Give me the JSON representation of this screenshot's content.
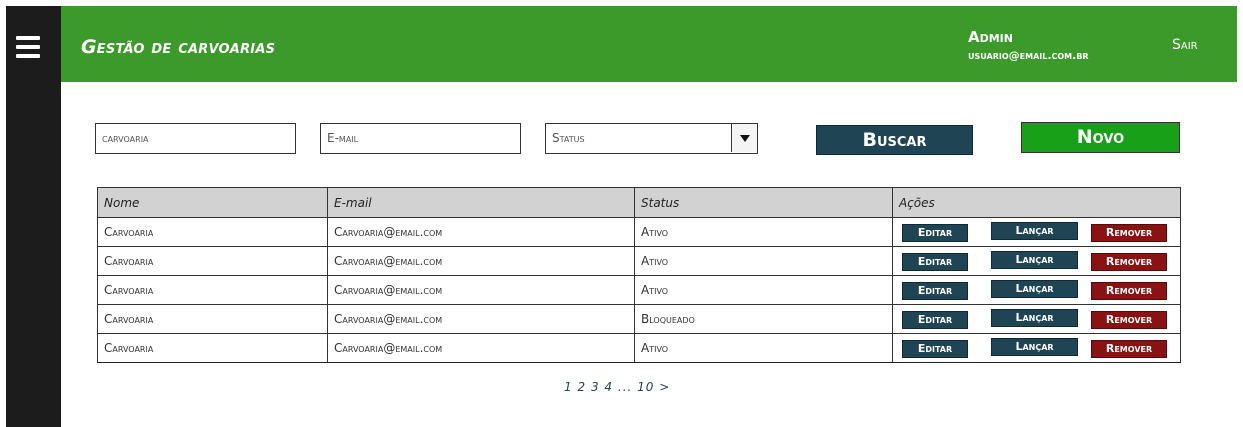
{
  "header": {
    "title": "Gestão de carvoarias",
    "user_name": "Admin",
    "user_email": "usuario@email.com.br",
    "logout_label": "Sair",
    "accent_color": "#3b9a2a"
  },
  "filters": {
    "carvoaria_placeholder": "carvoaria",
    "email_placeholder": "E-mail",
    "status_value": "Status",
    "search_label": "Buscar",
    "new_label": "Novo"
  },
  "table": {
    "headers": [
      "Nome",
      "E-mail",
      "Status",
      "Ações"
    ],
    "rows": [
      {
        "nome": "Carvoaria",
        "email": "Carvoaria@email.com",
        "status": "Ativo"
      },
      {
        "nome": "Carvoaria",
        "email": "Carvoaria@email.com",
        "status": "Ativo"
      },
      {
        "nome": "Carvoaria",
        "email": "Carvoaria@email.com",
        "status": "Ativo"
      },
      {
        "nome": "Carvoaria",
        "email": "Carvoaria@email.com",
        "status": "Bloqueado"
      },
      {
        "nome": "Carvoaria",
        "email": "Carvoaria@email.com",
        "status": "Ativo"
      }
    ],
    "actions": {
      "edit": "Editar",
      "launch": "Lançar",
      "remove": "Remover"
    }
  },
  "pagination": {
    "pages": [
      "1",
      "2",
      "3",
      "4",
      "...",
      "10",
      ">"
    ]
  },
  "colors": {
    "primary_dark": "#1f4454",
    "success": "#18a018",
    "danger": "#8b1212"
  }
}
